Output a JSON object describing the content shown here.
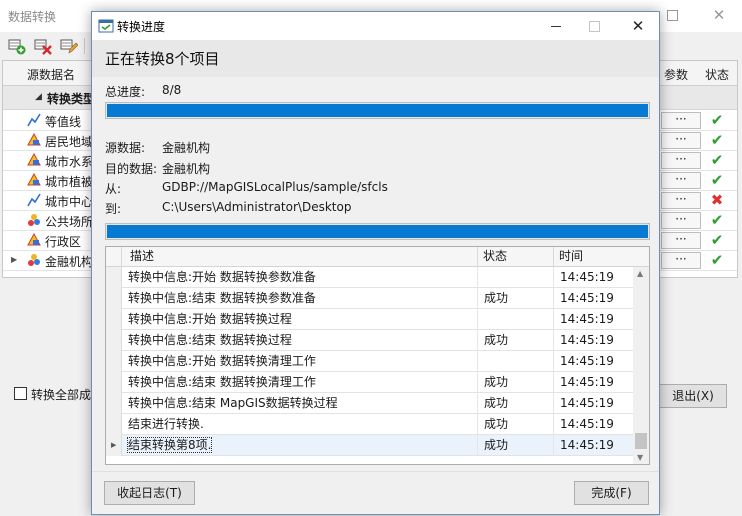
{
  "main_window": {
    "title": "数据转换",
    "toolbar": {
      "add_icon": "add-icon",
      "delete_icon": "delete-icon",
      "edit_icon": "edit-icon"
    },
    "grid": {
      "headers": {
        "source_name": "源数据名",
        "params": "参数",
        "status": "状态"
      },
      "group_label": "转换类型",
      "rows": [
        {
          "name": "等值线",
          "icon": "line-icon",
          "param_button": "···",
          "status": "ok"
        },
        {
          "name": "居民地域",
          "icon": "polygon-icon",
          "param_button": "···",
          "status": "ok"
        },
        {
          "name": "城市水系",
          "icon": "polygon-icon",
          "param_button": "···",
          "status": "ok"
        },
        {
          "name": "城市植被",
          "icon": "polygon-icon",
          "param_button": "···",
          "status": "ok"
        },
        {
          "name": "城市中心",
          "icon": "line-icon",
          "param_button": "···",
          "status": "error"
        },
        {
          "name": "公共场所",
          "icon": "point-icon",
          "param_button": "···",
          "status": "ok"
        },
        {
          "name": "行政区",
          "icon": "polygon-icon",
          "param_button": "···",
          "status": "ok"
        },
        {
          "name": "金融机构",
          "icon": "point-icon",
          "param_button": "···",
          "status": "ok"
        }
      ]
    },
    "convert_all_label": "转换全部成",
    "exit_label": "退出(X)"
  },
  "dialog": {
    "title": "转换进度",
    "heading": "正在转换8个项目",
    "total_label": "总进度:",
    "total_value": "8/8",
    "total_progress": 1.0,
    "source_label": "源数据:",
    "source_value": "金融机构",
    "target_label": "目的数据:",
    "target_value": "金融机构",
    "from_label": "从:",
    "from_value": "GDBP://MapGISLocalPlus/sample/sfcls",
    "to_label": "到:",
    "to_value": "C:\\Users\\Administrator\\Desktop",
    "item_progress": 1.0,
    "log": {
      "headers": {
        "desc": "描述",
        "status": "状态",
        "time": "时间"
      },
      "rows": [
        {
          "desc": "转换中信息:开始 数据转换参数准备",
          "status": "",
          "time": "14:45:19"
        },
        {
          "desc": "转换中信息:结束 数据转换参数准备",
          "status": "成功",
          "time": "14:45:19"
        },
        {
          "desc": "转换中信息:开始 数据转换过程",
          "status": "",
          "time": "14:45:19"
        },
        {
          "desc": "转换中信息:结束 数据转换过程",
          "status": "成功",
          "time": "14:45:19"
        },
        {
          "desc": "转换中信息:开始 数据转换清理工作",
          "status": "",
          "time": "14:45:19"
        },
        {
          "desc": "转换中信息:结束 数据转换清理工作",
          "status": "成功",
          "time": "14:45:19"
        },
        {
          "desc": "转换中信息:结束 MapGIS数据转换过程",
          "status": "成功",
          "time": "14:45:19"
        },
        {
          "desc": "结束进行转换.",
          "status": "成功",
          "time": "14:45:19"
        },
        {
          "desc": "结束转换第8项.",
          "status": "成功",
          "time": "14:45:19"
        }
      ]
    },
    "collapse_log_label": "收起日志(T)",
    "finish_label": "完成(F)"
  }
}
